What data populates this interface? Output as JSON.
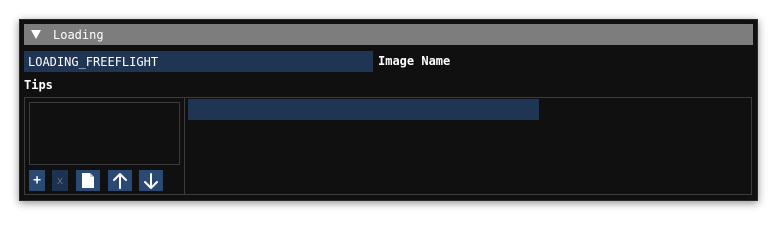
{
  "panel": {
    "title": "Loading",
    "expanded": true
  },
  "image_name": {
    "value": "LOADING_FREEFLIGHT",
    "label": "Image Name"
  },
  "tips": {
    "label": "Tips",
    "items": [],
    "selected_value": ""
  },
  "toolbar": {
    "add_label": "+",
    "remove_label": "x",
    "copy_icon": "copy-icon",
    "up_icon": "arrow-up-icon",
    "down_icon": "arrow-down-icon"
  },
  "colors": {
    "header_bg": "#7d7d7d",
    "input_bg": "#1f3553",
    "button_bg": "#2b4a73",
    "window_bg": "#101010"
  }
}
